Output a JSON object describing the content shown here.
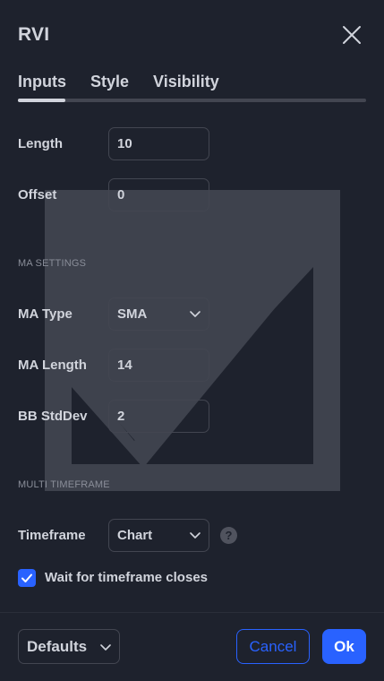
{
  "dialog": {
    "title": "RVI"
  },
  "tabs": [
    {
      "label": "Inputs",
      "active": true
    },
    {
      "label": "Style",
      "active": false
    },
    {
      "label": "Visibility",
      "active": false
    }
  ],
  "inputs": {
    "length": {
      "label": "Length",
      "value": "10"
    },
    "offset": {
      "label": "Offset",
      "value": "0"
    }
  },
  "ma_settings": {
    "section_label": "MA SETTINGS",
    "ma_type": {
      "label": "MA Type",
      "value": "SMA"
    },
    "ma_length": {
      "label": "MA Length",
      "value": "14"
    },
    "bb_stddev": {
      "label": "BB StdDev",
      "value": "2"
    }
  },
  "multi_timeframe": {
    "section_label": "MULTI TIMEFRAME",
    "timeframe": {
      "label": "Timeframe",
      "value": "Chart"
    },
    "help_glyph": "?",
    "wait_for_close": {
      "label": "Wait for timeframe closes",
      "checked": true
    }
  },
  "footer": {
    "defaults_label": "Defaults",
    "cancel_label": "Cancel",
    "ok_label": "Ok"
  },
  "colors": {
    "background": "#1e222d",
    "text": "#d1d4dc",
    "accent": "#2962ff",
    "border": "#434651",
    "muted": "#8a8e99"
  },
  "icons": {
    "close": "close-icon",
    "chevron": "chevron-down-icon",
    "help": "help-icon",
    "check": "check-icon",
    "watermark": "checkmark-watermark"
  }
}
